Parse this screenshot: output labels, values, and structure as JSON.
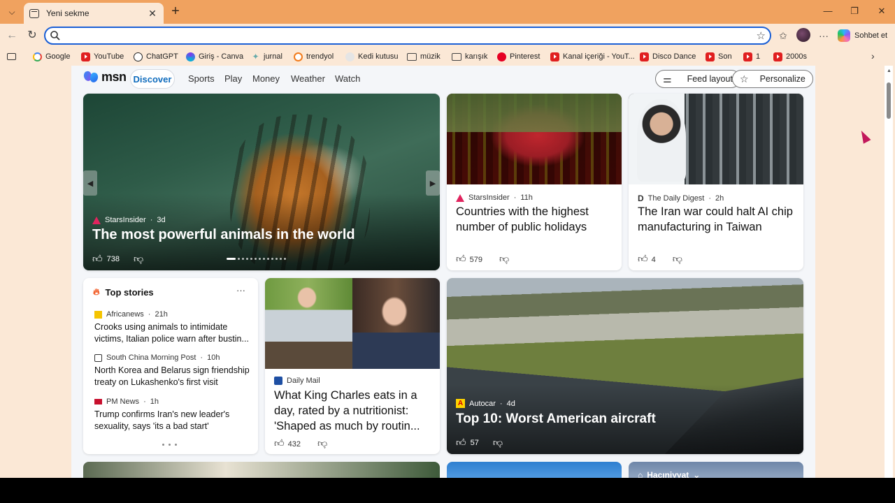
{
  "browser": {
    "tab_title": "Yeni sekme",
    "address_value": "",
    "sohbet_label": "Sohbet et"
  },
  "bookmarks": [
    {
      "label": "Google",
      "icon": "google-icon"
    },
    {
      "label": "YouTube",
      "icon": "youtube-icon"
    },
    {
      "label": "ChatGPT",
      "icon": "chatgpt-icon"
    },
    {
      "label": "Giriş - Canva",
      "icon": "canva-icon"
    },
    {
      "label": "jurnal",
      "icon": "jurnal-icon"
    },
    {
      "label": "trendyol",
      "icon": "trendyol-icon"
    },
    {
      "label": "Kedi kutusu",
      "icon": "kedi-icon"
    },
    {
      "label": "müzik",
      "icon": "folder-icon"
    },
    {
      "label": "karışık",
      "icon": "folder-icon"
    },
    {
      "label": "Pinterest",
      "icon": "pinterest-icon"
    },
    {
      "label": "Kanal içeriği - YouT...",
      "icon": "youtube-icon"
    },
    {
      "label": "Disco Dance",
      "icon": "youtube-icon"
    },
    {
      "label": "Son",
      "icon": "youtube-icon"
    },
    {
      "label": "1",
      "icon": "youtube-icon"
    },
    {
      "label": "2000s",
      "icon": "youtube-icon"
    }
  ],
  "msn": {
    "logo_text": "msn",
    "tabs": [
      "Discover",
      "Sports",
      "Play",
      "Money",
      "Weather",
      "Watch"
    ],
    "feed_layout": "Feed layout",
    "personalize": "Personalize"
  },
  "hero": {
    "source": "StarsInsider",
    "age": "3d",
    "title": "The most powerful animals in the world",
    "likes": "738"
  },
  "card_holidays": {
    "source": "StarsInsider",
    "age": "11h",
    "title": "Countries with the highest number of public holidays",
    "likes": "579"
  },
  "card_iran": {
    "source": "The Daily Digest",
    "age": "2h",
    "title": "The Iran war could halt AI chip manufacturing in Taiwan",
    "likes": "4"
  },
  "top_stories": {
    "header": "Top stories",
    "items": [
      {
        "source": "Africanews",
        "age": "21h",
        "title": "Crooks using animals to intimidate victims, Italian police warn after bustin..."
      },
      {
        "source": "South China Morning Post",
        "age": "10h",
        "title": "North Korea and Belarus sign friendship treaty on Lukashenko's first visit"
      },
      {
        "source": "PM News",
        "age": "1h",
        "title": "Trump confirms Iran's new leader's sexuality, says 'its a bad start'"
      }
    ]
  },
  "card_charles": {
    "source": "Daily Mail",
    "title": "What King Charles eats in a day, rated by a nutritionist: 'Shaped as much by routin...",
    "likes": "432"
  },
  "card_aircraft": {
    "source": "Autocar",
    "age": "4d",
    "title": "Top 10: Worst American aircraft",
    "likes": "57"
  },
  "bottom_card": {
    "label": "Hacıniyyat"
  },
  "colors": {
    "chrome": "#f0a25f",
    "toolbar": "#fbe8d6",
    "accent": "#0f6cbd",
    "address_border": "#1a5fd6"
  }
}
